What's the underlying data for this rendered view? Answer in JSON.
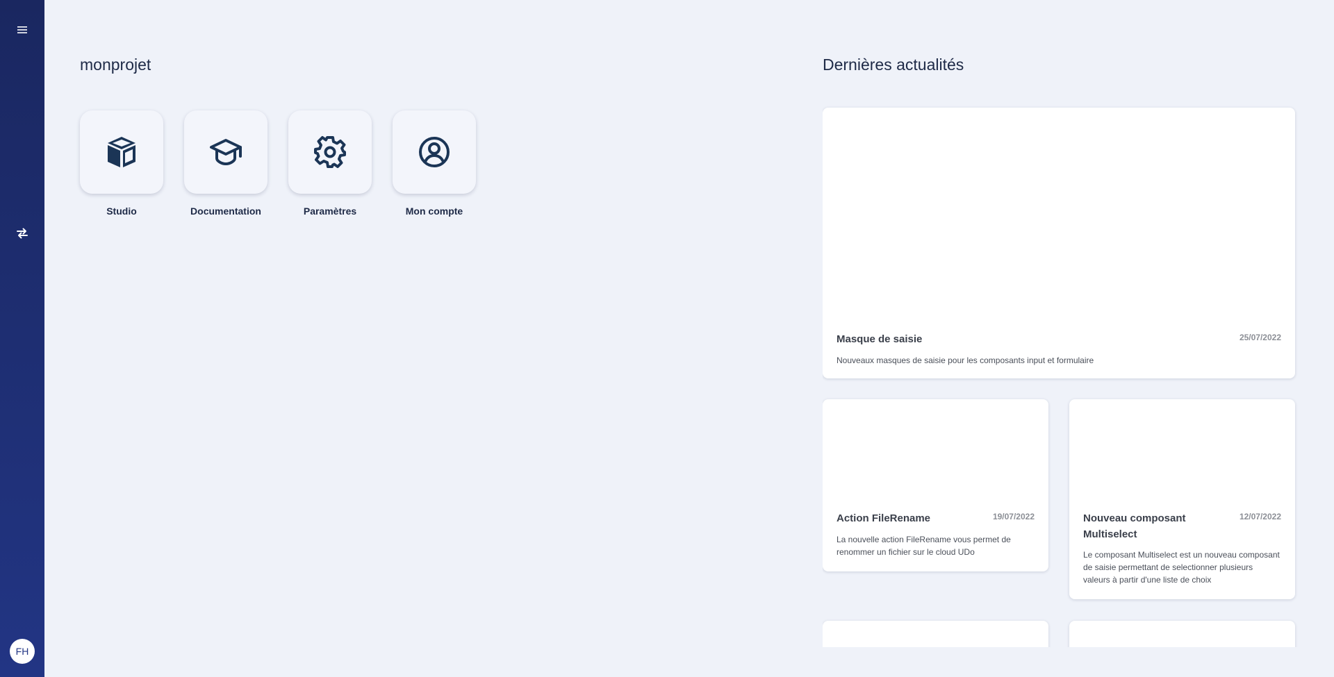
{
  "sidebar": {
    "menu_icon": "menu-icon",
    "swap_icon": "swap-arrows-icon",
    "avatar_initials": "FH"
  },
  "project": {
    "title": "monprojet"
  },
  "apps": [
    {
      "label": "Studio",
      "icon": "cube-icon"
    },
    {
      "label": "Documentation",
      "icon": "graduation-cap-icon"
    },
    {
      "label": "Paramètres",
      "icon": "gear-icon"
    },
    {
      "label": "Mon compte",
      "icon": "user-circle-icon"
    }
  ],
  "news": {
    "title": "Dernières actualités",
    "items": [
      {
        "title": "Masque de saisie",
        "date": "25/07/2022",
        "description": "Nouveaux masques de saisie pour les composants input et formulaire"
      },
      {
        "title": "Action FileRename",
        "date": "19/07/2022",
        "description": "La nouvelle action FileRename vous permet de renommer un fichier sur le cloud UDo"
      },
      {
        "title": "Nouveau composant Multiselect",
        "date": "12/07/2022",
        "description": "Le composant Multiselect est un nouveau composant de saisie permettant de selectionner plusieurs valeurs à partir d'une liste de choix"
      }
    ]
  },
  "colors": {
    "sidebar_top": "#1a2760",
    "sidebar_bottom": "#223584",
    "background": "#eff2f9",
    "icon_color": "#1b3556"
  }
}
